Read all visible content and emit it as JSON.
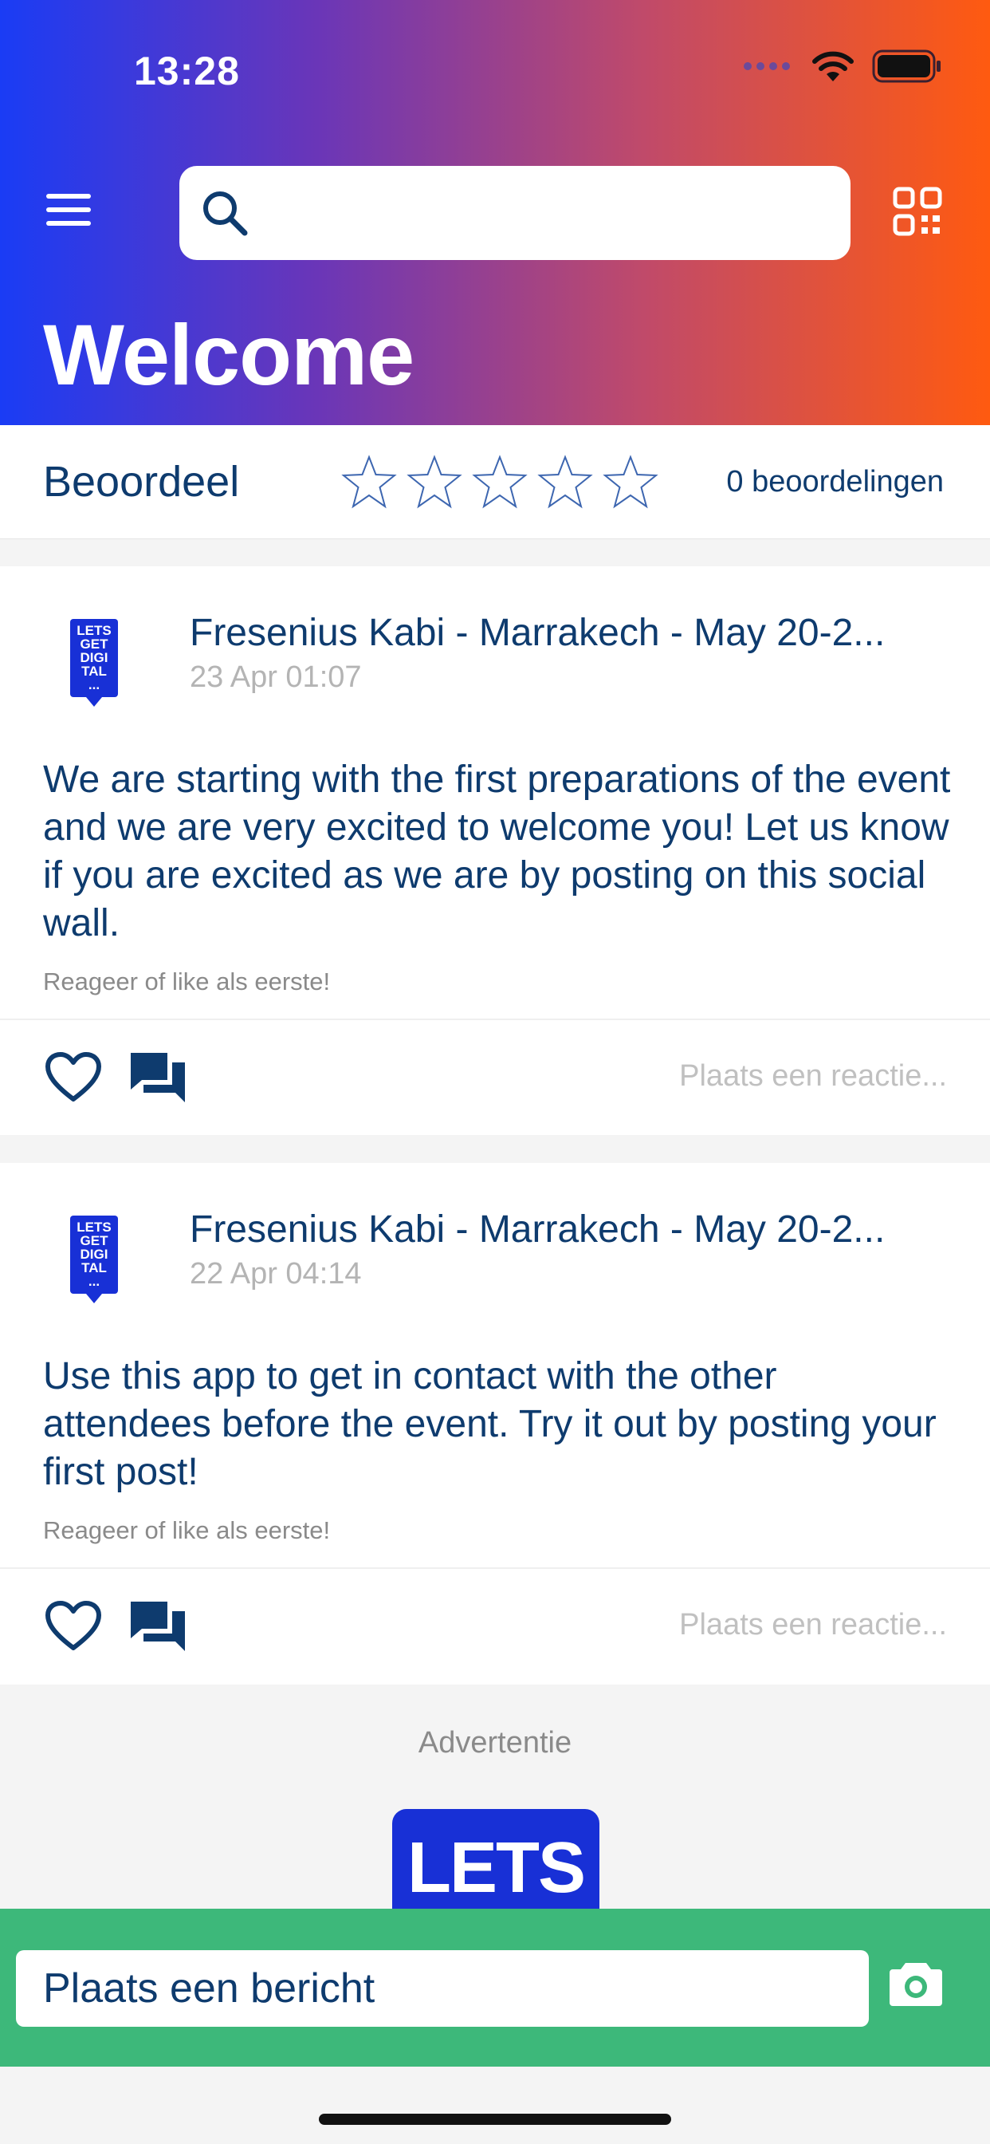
{
  "status_bar": {
    "time": "13:28"
  },
  "header": {
    "title": "Welcome",
    "search_placeholder": ""
  },
  "rating": {
    "label": "Beoordeel",
    "count_text": "0 beoordelingen",
    "stars_filled": 0,
    "stars_total": 5
  },
  "posts": [
    {
      "logo_text": "LETS GET DIGI TAL ...",
      "author": "Fresenius Kabi - Marrakech - May 20-2...",
      "timestamp": "23 Apr 01:07",
      "body": "We are starting with the first preparations of the event and we are very excited to welcome you! Let us know if you are excited as we are by posting on this social wall.",
      "react_hint": "Reageer of like als eerste!",
      "comment_placeholder": "Plaats een reactie..."
    },
    {
      "logo_text": "LETS GET DIGI TAL ...",
      "author": "Fresenius Kabi - Marrakech - May 20-2...",
      "timestamp": "22 Apr 04:14",
      "body": "Use this app to get in contact with the other attendees before the event. Try it out by posting your first post!",
      "react_hint": "Reageer of like als eerste!",
      "comment_placeholder": "Plaats een reactie..."
    }
  ],
  "ad": {
    "label": "Advertentie",
    "logo_text": "LETS GET"
  },
  "composer": {
    "placeholder": "Plaats een bericht"
  },
  "icons": {
    "menu": "menu-icon",
    "search": "search-icon",
    "qr": "qr-code-icon",
    "star": "star-outline-icon",
    "like": "heart-outline-icon",
    "comment": "chat-bubbles-icon",
    "camera": "camera-icon"
  },
  "colors": {
    "gradient_start": "#1a3cf5",
    "gradient_end": "#ff5a10",
    "primary_text": "#0e3b6e",
    "composer_bar": "#3db87a",
    "logo_blue": "#1830d6"
  }
}
